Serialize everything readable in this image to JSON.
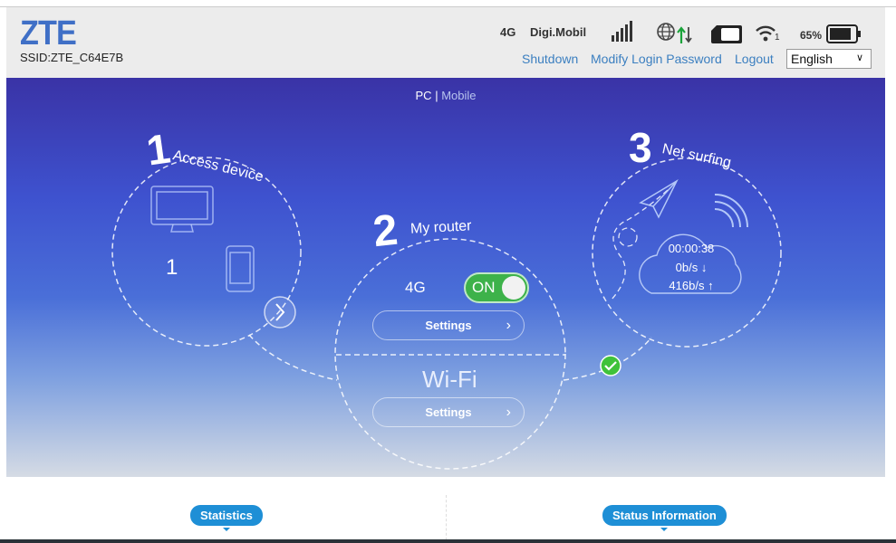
{
  "header": {
    "logo": "ZTE",
    "ssid": "SSID:ZTE_C64E7B",
    "network_type": "4G",
    "operator": "Digi.Mobil",
    "wifi_clients": "1",
    "battery": "65%",
    "links": {
      "shutdown": "Shutdown",
      "modify_password": "Modify Login Password",
      "logout": "Logout"
    },
    "language": "English"
  },
  "view": {
    "pc": "PC",
    "sep": "|",
    "mobile": "Mobile"
  },
  "step1": {
    "num": "1",
    "title": "Access device",
    "devices": "1"
  },
  "step2": {
    "num": "2",
    "title": "My router",
    "net_label": "4G",
    "toggle": "ON",
    "settings1": "Settings",
    "wifi_label": "Wi-Fi",
    "settings2": "Settings"
  },
  "step3": {
    "num": "3",
    "title": "Net surfing",
    "duration": "00:00:38",
    "down": "0b/s ↓",
    "up": "416b/s ↑"
  },
  "bottom": {
    "statistics": "Statistics",
    "status": "Status Information"
  },
  "colors": {
    "accent": "#3b7fc0",
    "toggle_on": "#3db24a",
    "bubble": "#1e8fd6"
  }
}
